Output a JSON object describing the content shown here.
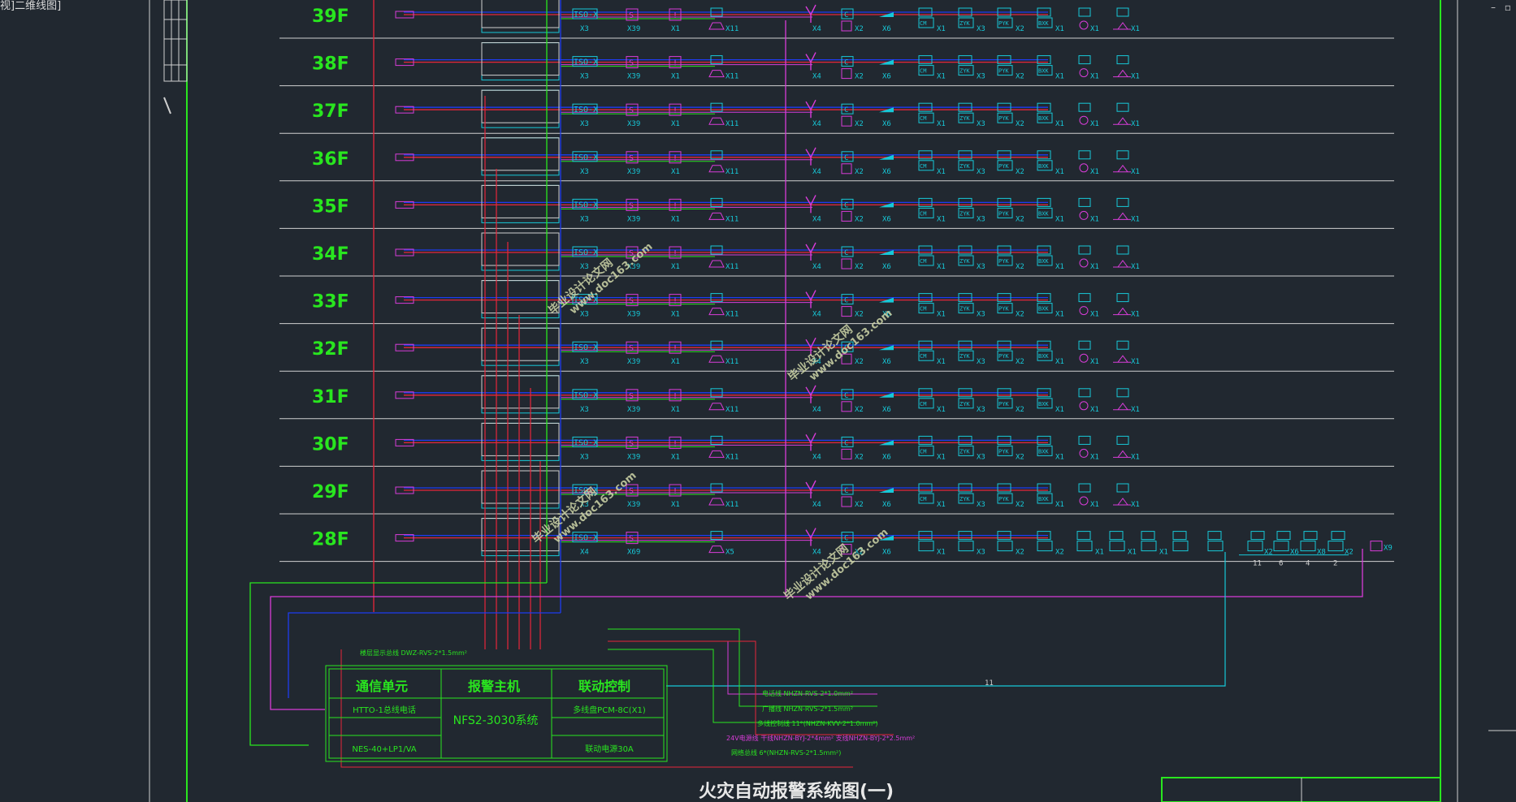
{
  "app": {
    "view_label": "视]二维线图]",
    "window_controls": [
      "–",
      "▫"
    ]
  },
  "drawing": {
    "title": "火灾自动报警系统图(一)",
    "floors": [
      "39F",
      "38F",
      "37F",
      "36F",
      "35F",
      "34F",
      "33F",
      "32F",
      "31F",
      "30F",
      "29F",
      "28F"
    ],
    "symbols": {
      "iso": "ISO-X",
      "cm": "CM",
      "zyk": "ZYK",
      "pyk": "PYK",
      "bxk": "BXK"
    },
    "counts": {
      "iso": "X3",
      "smoke": "X39",
      "heat": "X1",
      "alarm": "X11",
      "sw": "X4",
      "c1": "X2",
      "c2": "X6",
      "m1": "X1",
      "m2": "X3",
      "m3": "X2",
      "m4": "X1",
      "m5": "X1",
      "m6": "X1"
    },
    "floor28_counts": {
      "iso": "X4",
      "smoke": "X69",
      "alarm": "X5",
      "end": "X9",
      "tail": [
        "X1",
        "X3",
        "X2",
        "X2",
        "X1",
        "X1",
        "X1"
      ],
      "bottom": [
        "X2",
        "X6",
        "X8",
        "X2"
      ],
      "marks": [
        "11",
        "6",
        "4",
        "2"
      ]
    },
    "bus_label": "11",
    "controller": {
      "headers": [
        "通信单元",
        "报警主机",
        "联动控制"
      ],
      "row1_left": "HTTO-1总线电话",
      "center": "NFS2-3030系统",
      "row1_right": "多线盘PCM-8C(X1)",
      "row2_left": "NES-40+LP1/VA",
      "row2_right": "联动电源30A"
    },
    "bus_top_label": "楼层显示总线 DWZ-RVS-2*1.5mm²",
    "cable_notes": [
      "电话线    NHZN-RVS-2*1.0mm²",
      "广播线    NHZN-RVS-2*1.5mm²",
      "多线控制线    11*(NHZN-KVV-2*1.0mm²)",
      "24V电源线 干线NHZN-BYJ-2*4mm²   支线NHZN-BYJ-2*2.5mm²",
      "网络总线    6*(NHZN-RVS-2*1.5mm²)"
    ],
    "watermark": {
      "line1": "毕业设计论文网",
      "line2": "www.doc163.com"
    },
    "colors": {
      "background": "#212830",
      "green": "#29e61f",
      "cyan": "#17c8d8",
      "red": "#e8263a",
      "magenta": "#d83cd8",
      "blue": "#1e3cf0",
      "white": "#d0d0d0"
    }
  }
}
